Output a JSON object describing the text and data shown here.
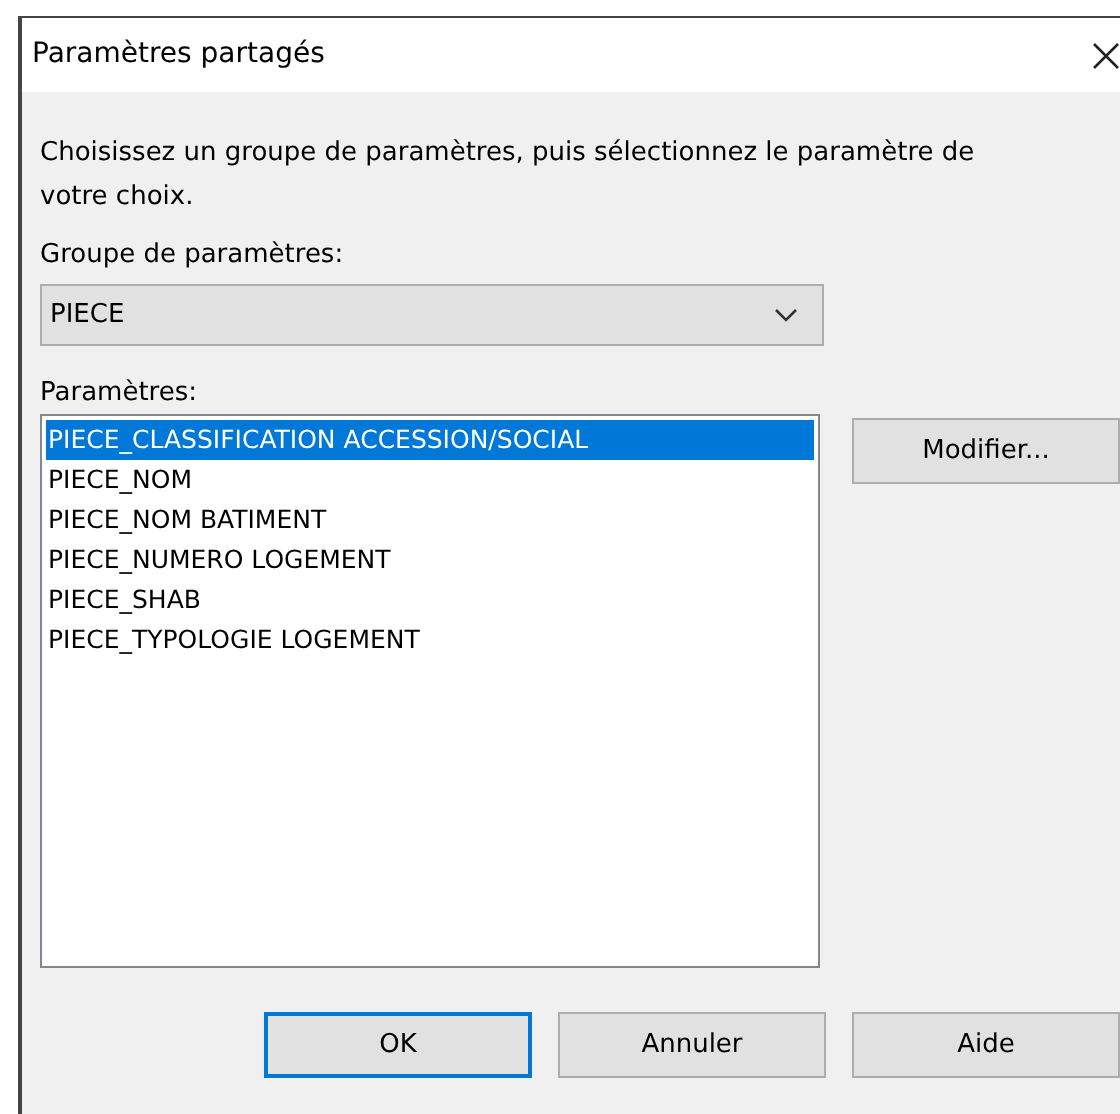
{
  "window": {
    "title": "Paramètres partagés"
  },
  "instructions": "Choisissez un groupe de paramètres, puis sélectionnez le paramètre de votre choix.",
  "group": {
    "label": "Groupe de paramètres:",
    "value": "PIECE"
  },
  "parameters": {
    "label": "Paramètres:",
    "items": [
      {
        "label": "PIECE_CLASSIFICATION ACCESSION/SOCIAL",
        "selected": true
      },
      {
        "label": "PIECE_NOM",
        "selected": false
      },
      {
        "label": "PIECE_NOM BATIMENT",
        "selected": false
      },
      {
        "label": "PIECE_NUMERO LOGEMENT",
        "selected": false
      },
      {
        "label": "PIECE_SHAB",
        "selected": false
      },
      {
        "label": "PIECE_TYPOLOGIE LOGEMENT",
        "selected": false
      }
    ]
  },
  "modify_button": "Modifier...",
  "buttons": [
    {
      "label": "OK",
      "default": true
    },
    {
      "label": "Annuler",
      "default": false
    },
    {
      "label": "Aide",
      "default": false
    }
  ]
}
